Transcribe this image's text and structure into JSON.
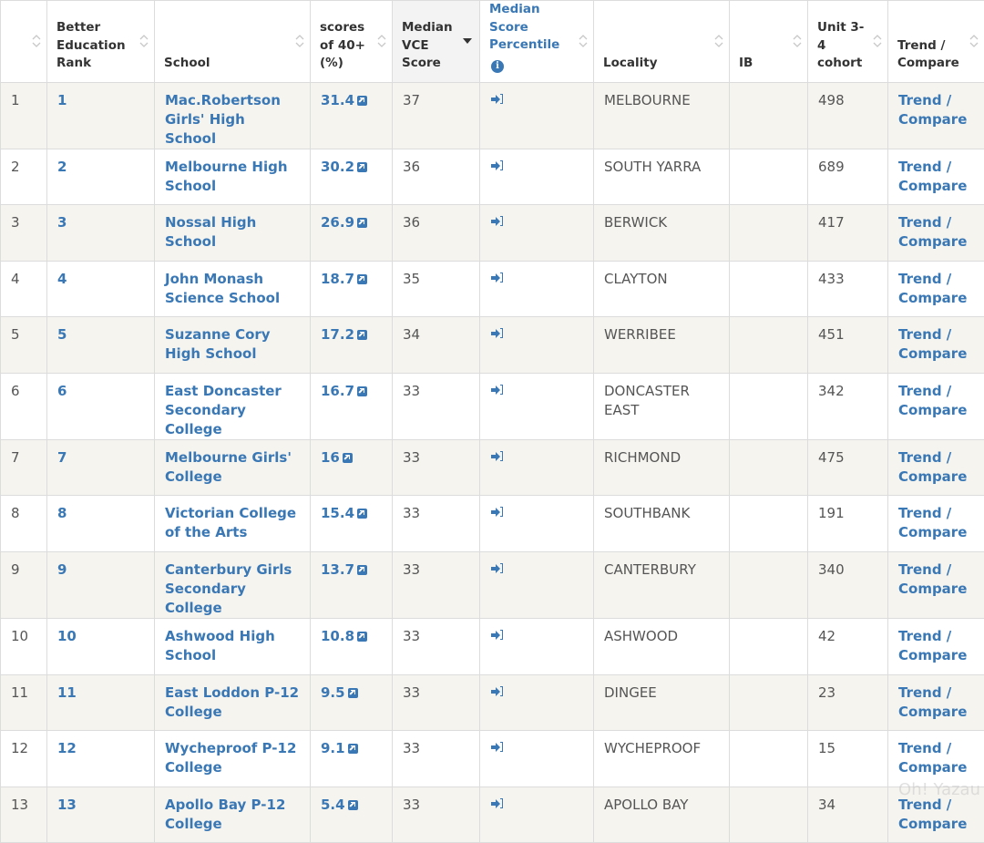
{
  "headers": {
    "idx": "",
    "rank": "Better Education Rank",
    "school": "School",
    "scores40": "scores of 40+ (%)",
    "median_vce": "Median VCE Score",
    "percentile": "Median Score Percentile",
    "locality": "Locality",
    "ib": "IB",
    "cohort": "Unit 3-4 cohort",
    "trend": "Trend / Compare"
  },
  "rows": [
    {
      "idx": "1",
      "rank": "1",
      "school": "Mac.Robertson Girls' High School",
      "scores40": "31.4",
      "median": "37",
      "locality": "MELBOURNE",
      "ib": "",
      "cohort": "498",
      "trend": "Trend / Compare"
    },
    {
      "idx": "2",
      "rank": "2",
      "school": "Melbourne High School",
      "scores40": "30.2",
      "median": "36",
      "locality": "SOUTH YARRA",
      "ib": "",
      "cohort": "689",
      "trend": "Trend / Compare"
    },
    {
      "idx": "3",
      "rank": "3",
      "school": "Nossal High School",
      "scores40": "26.9",
      "median": "36",
      "locality": "BERWICK",
      "ib": "",
      "cohort": "417",
      "trend": "Trend / Compare"
    },
    {
      "idx": "4",
      "rank": "4",
      "school": "John Monash Science School",
      "scores40": "18.7",
      "median": "35",
      "locality": "CLAYTON",
      "ib": "",
      "cohort": "433",
      "trend": "Trend / Compare"
    },
    {
      "idx": "5",
      "rank": "5",
      "school": "Suzanne Cory High School",
      "scores40": "17.2",
      "median": "34",
      "locality": "WERRIBEE",
      "ib": "",
      "cohort": "451",
      "trend": "Trend / Compare"
    },
    {
      "idx": "6",
      "rank": "6",
      "school": "East Doncaster Secondary College",
      "scores40": "16.7",
      "median": "33",
      "locality": "DONCASTER EAST",
      "ib": "",
      "cohort": "342",
      "trend": "Trend / Compare"
    },
    {
      "idx": "7",
      "rank": "7",
      "school": "Melbourne Girls' College",
      "scores40": "16",
      "median": "33",
      "locality": "RICHMOND",
      "ib": "",
      "cohort": "475",
      "trend": "Trend / Compare"
    },
    {
      "idx": "8",
      "rank": "8",
      "school": "Victorian College of the Arts",
      "scores40": "15.4",
      "median": "33",
      "locality": "SOUTHBANK",
      "ib": "",
      "cohort": "191",
      "trend": "Trend / Compare"
    },
    {
      "idx": "9",
      "rank": "9",
      "school": "Canterbury Girls Secondary College",
      "scores40": "13.7",
      "median": "33",
      "locality": "CANTERBURY",
      "ib": "",
      "cohort": "340",
      "trend": "Trend / Compare"
    },
    {
      "idx": "10",
      "rank": "10",
      "school": "Ashwood High School",
      "scores40": "10.8",
      "median": "33",
      "locality": "ASHWOOD",
      "ib": "",
      "cohort": "42",
      "trend": "Trend / Compare"
    },
    {
      "idx": "11",
      "rank": "11",
      "school": "East Loddon P-12 College",
      "scores40": "9.5",
      "median": "33",
      "locality": "DINGEE",
      "ib": "",
      "cohort": "23",
      "trend": "Trend / Compare"
    },
    {
      "idx": "12",
      "rank": "12",
      "school": "Wycheproof P-12 College",
      "scores40": "9.1",
      "median": "33",
      "locality": "WYCHEPROOF",
      "ib": "",
      "cohort": "15",
      "trend": "Trend / Compare"
    },
    {
      "idx": "13",
      "rank": "13",
      "school": "Apollo Bay P-12 College",
      "scores40": "5.4",
      "median": "33",
      "locality": "APOLLO BAY",
      "ib": "",
      "cohort": "34",
      "trend": "Trend / Compare"
    }
  ],
  "watermark": "Oh! Yazau"
}
